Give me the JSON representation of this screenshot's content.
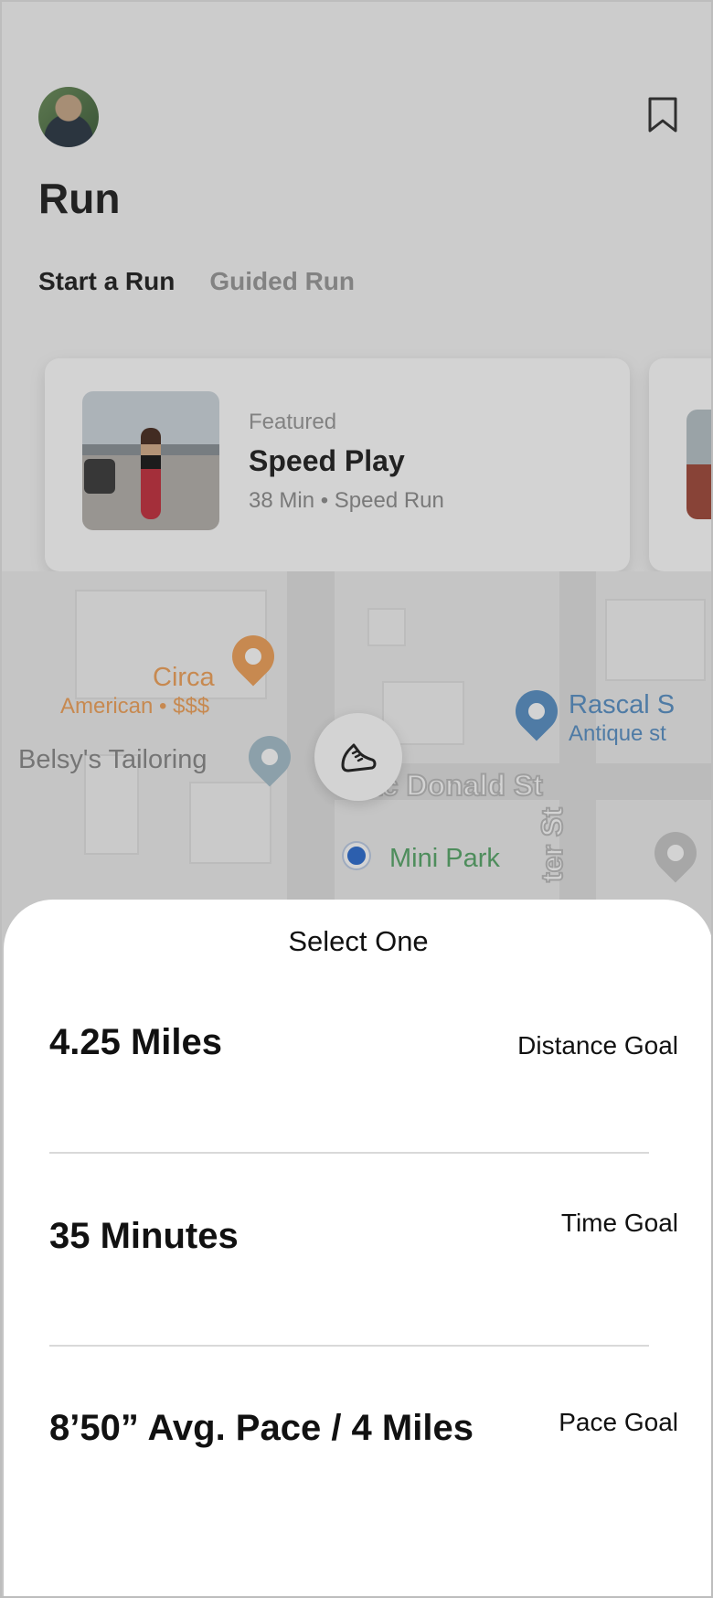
{
  "header": {
    "title": "Run",
    "tabs": [
      {
        "label": "Start a Run",
        "active": true
      },
      {
        "label": "Guided Run",
        "active": false
      }
    ]
  },
  "featured": {
    "eyebrow": "Featured",
    "title": "Speed Play",
    "meta": "38 Min • Speed Run"
  },
  "map": {
    "poi_circa": "Circa",
    "poi_circa_sub": "American • $$$",
    "poi_tailoring": "Belsy's Tailoring",
    "poi_rascal": "Rascal S",
    "poi_rascal_sub": "Antique st",
    "street_macdonald": "ac Donald St",
    "street_vertical": "ter St",
    "poi_minipark": "Mini Park"
  },
  "sheet": {
    "title": "Select One",
    "options": [
      {
        "value": "4.25 Miles",
        "type": "Distance Goal"
      },
      {
        "value": "35 Minutes",
        "type": "Time Goal"
      },
      {
        "value": "8’50” Avg. Pace / 4 Miles",
        "type": "Pace Goal"
      }
    ]
  },
  "colors": {
    "overlay": "#232323",
    "accent_blue": "#2f6fd1",
    "poi_orange": "#f0a35c"
  }
}
